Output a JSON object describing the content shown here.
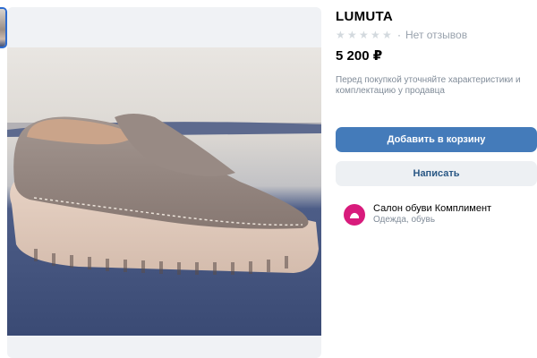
{
  "product": {
    "title": "LUMUTA",
    "rating_text": "Нет отзывов",
    "rating_stars_filled": 0,
    "rating_stars_total": 5,
    "price": "5 200 ₽",
    "note": "Перед покупкой уточняйте характеристики и комплектацию у продавца"
  },
  "actions": {
    "add_to_cart": "Добавить в корзину",
    "write": "Написать"
  },
  "seller": {
    "name": "Салон обуви Комплимент",
    "category": "Одежда, обувь"
  },
  "colors": {
    "primary_button": "#447bba",
    "secondary_button": "#edf0f3",
    "avatar": "#d81b7c"
  }
}
